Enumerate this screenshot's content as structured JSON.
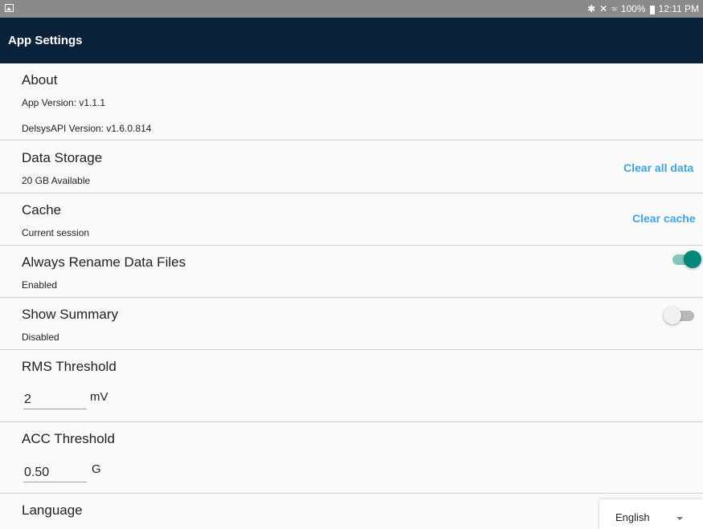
{
  "status_bar": {
    "right_text": "100%",
    "time": "12:11 PM"
  },
  "header": {
    "title": "App Settings"
  },
  "about": {
    "title": "About",
    "app_version": "App Version: v1.1.1",
    "api_version": "DelsysAPI Version: v1.6.0.814"
  },
  "data_storage": {
    "title": "Data Storage",
    "subtitle": "20 GB Available",
    "action": "Clear all data"
  },
  "cache": {
    "title": "Cache",
    "subtitle": "Current session",
    "action": "Clear cache"
  },
  "rename": {
    "title": "Always Rename Data Files",
    "subtitle": "Enabled",
    "enabled": true
  },
  "summary": {
    "title": "Show Summary",
    "subtitle": "Disabled",
    "enabled": false
  },
  "rms": {
    "title": "RMS Threshold",
    "value": "2",
    "unit": "mV"
  },
  "acc": {
    "title": "ACC Threshold",
    "value": "0.50",
    "unit": "G"
  },
  "language": {
    "title": "Language",
    "selected": "English"
  },
  "colors": {
    "appbar": "#0a2239",
    "accent": "#3fa2e8",
    "toggle_on": "#00897b"
  }
}
